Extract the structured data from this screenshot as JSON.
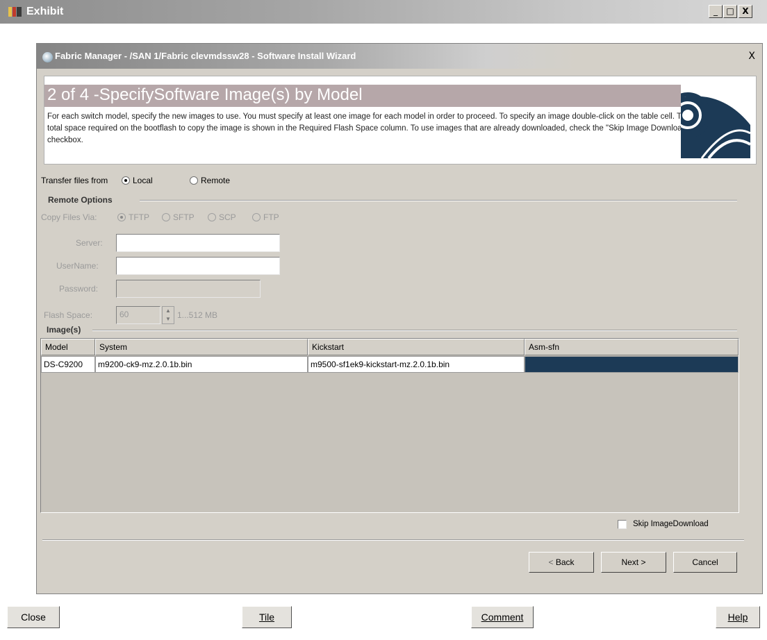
{
  "outer_window": {
    "title": "Exhibit",
    "minimize": "_",
    "maximize": "□",
    "close": "X"
  },
  "dialog": {
    "title": "Fabric Manager - /SAN 1/Fabric clevmdssw28 - Software Install Wizard",
    "close": "X",
    "heading": "2 of 4 -SpecifySoftware Image(s) by Model",
    "description": "For each switch model, specify the new images to use. You must specify at least one image for each model in order to proceed. To specify an image double-click on the table cell. The total space required on the bootflash to copy the image is shown in the Required Flash Space column. To use images that are already downloaded, check the \"Skip Image Download\" checkbox.",
    "transfer": {
      "label": "Transfer files from",
      "options": [
        "Local",
        "Remote"
      ],
      "selected": "Local"
    },
    "remote_options": {
      "title": "Remote Options",
      "copy_via_label": "Copy Files Via:",
      "copy_via_options": [
        "TFTP",
        "SFTP",
        "SCP",
        "FTP"
      ],
      "copy_via_selected": "TFTP",
      "server_label": "Server:",
      "server_value": "",
      "username_label": "UserName:",
      "username_value": "",
      "password_label": "Password:",
      "password_value": "",
      "flash_label": "Flash Space:",
      "flash_value": "60",
      "flash_range": "1...512 MB"
    },
    "images": {
      "title": "Image(s)",
      "columns": [
        "Model",
        "System",
        "Kickstart",
        "Asm-sfn"
      ],
      "rows": [
        [
          "DS-C9200",
          "m9200-ck9-mz.2.0.1b.bin",
          "m9500-sf1ek9-kickstart-mz.2.0.1b.bin",
          ""
        ]
      ]
    },
    "skip_download": {
      "label": "Skip ImageDownload",
      "checked": false
    },
    "buttons": {
      "back": "Back",
      "next": "Next",
      "cancel": "Cancel"
    }
  },
  "bottom_bar": {
    "close": "Close",
    "tile": "Tile",
    "comment": "Comment",
    "help": "Help"
  }
}
